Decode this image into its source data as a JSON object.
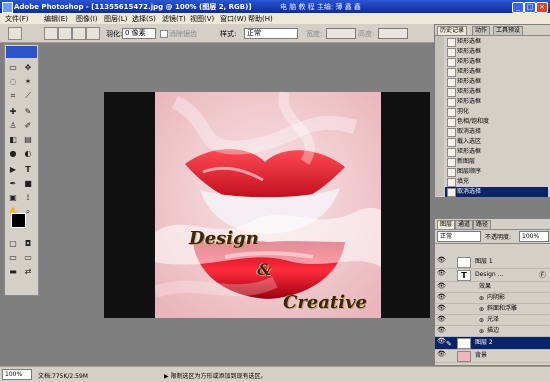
{
  "app": {
    "title": "Adobe Photoshop - [11355615472.jpg @ 100% (图层 2, RGB)]",
    "title_center": "电 脑 教 程     主编: 薄 鑫 鑫",
    "window_buttons": [
      "_",
      "□",
      "×"
    ]
  },
  "menu": {
    "items": [
      "文件(F)",
      "编辑(E)",
      "图像(I)",
      "图层(L)",
      "选择(S)",
      "滤镜(T)",
      "视图(V)",
      "窗口(W)",
      "帮助(H)"
    ]
  },
  "options_bar": {
    "feather_label": "羽化:",
    "feather_value": "0 像素",
    "antialias_label": "消除锯齿",
    "style_label": "样式:",
    "style_value": "正常",
    "width_label": "宽度:",
    "height_label": "高度:"
  },
  "canvas": {
    "text_line1": "Design",
    "text_line2": "&",
    "text_line3": "Creative"
  },
  "history_panel": {
    "tabs": [
      "历史记录",
      "动作",
      "工具预设"
    ],
    "items": [
      "矩形选框",
      "矩形选框",
      "矩形选框",
      "矩形选框",
      "矩形选框",
      "矩形选框",
      "矩形选框",
      "羽化",
      "色相/饱和度",
      "取消选择",
      "载入选区",
      "矩形选框",
      "新图层",
      "图层顺序",
      "填充",
      "取消选择"
    ],
    "selected_index": 15
  },
  "layers_panel": {
    "tabs": [
      "图层",
      "通道",
      "路径"
    ],
    "blend_mode": "正常",
    "opacity_label": "不透明度:",
    "opacity_value": "100%",
    "layers": [
      {
        "name": "图层 1",
        "type": "normal"
      },
      {
        "name": "Design ...",
        "type": "text",
        "fx": "Ⓕ"
      },
      {
        "name": "效果",
        "type": "effects-header"
      },
      {
        "name": "内阴影",
        "type": "effect"
      },
      {
        "name": "斜面和浮雕",
        "type": "effect"
      },
      {
        "name": "光泽",
        "type": "effect"
      },
      {
        "name": "描边",
        "type": "effect"
      },
      {
        "name": "图层 2",
        "type": "selected"
      },
      {
        "name": "背景",
        "type": "background"
      }
    ]
  },
  "status": {
    "zoom": "100%",
    "doc": "文档:775K/2.59M",
    "hint": "▶ 限制选区为方形或添加到现有选区。"
  }
}
